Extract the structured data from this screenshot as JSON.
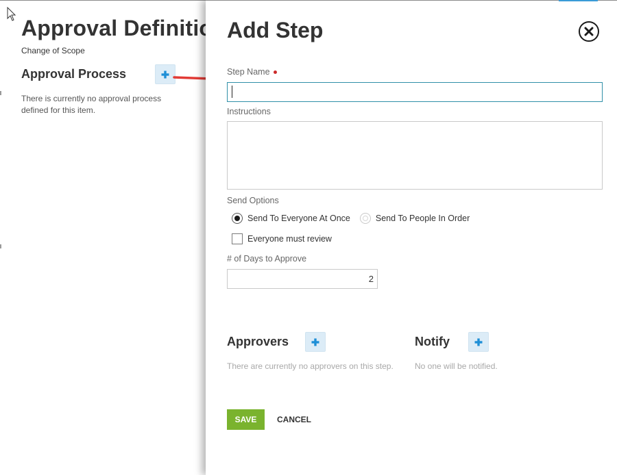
{
  "background": {
    "title": "Approval Definition",
    "subtitle": "Change of Scope",
    "section_title": "Approval Process",
    "empty_message": "There is currently no approval process defined for this item.",
    "add_icon": "plus-icon"
  },
  "panel": {
    "title": "Add Step",
    "close_icon": "close-circle-icon",
    "step_name": {
      "label": "Step Name",
      "value": "",
      "required": true
    },
    "instructions": {
      "label": "Instructions",
      "value": ""
    },
    "send_options": {
      "label": "Send Options",
      "options": [
        {
          "label": "Send To Everyone At Once",
          "selected": true
        },
        {
          "label": "Send To People In Order",
          "selected": false
        }
      ],
      "everyone_must_review": {
        "label": "Everyone must review",
        "checked": false
      }
    },
    "days_to_approve": {
      "label": "# of Days to Approve",
      "value": "2"
    },
    "approvers": {
      "title": "Approvers",
      "empty": "There are currently no approvers on this step."
    },
    "notify": {
      "title": "Notify",
      "empty": "No one will be notified."
    },
    "actions": {
      "save": "SAVE",
      "cancel": "CANCEL"
    }
  },
  "colors": {
    "save_green": "#7ab32e",
    "required_red": "#cc2b2b",
    "plus_blue": "#1e8fd6",
    "plus_bg": "#dcecf7",
    "focus_border": "#2f8fa8",
    "annotation_arrow": "#e23b36"
  }
}
